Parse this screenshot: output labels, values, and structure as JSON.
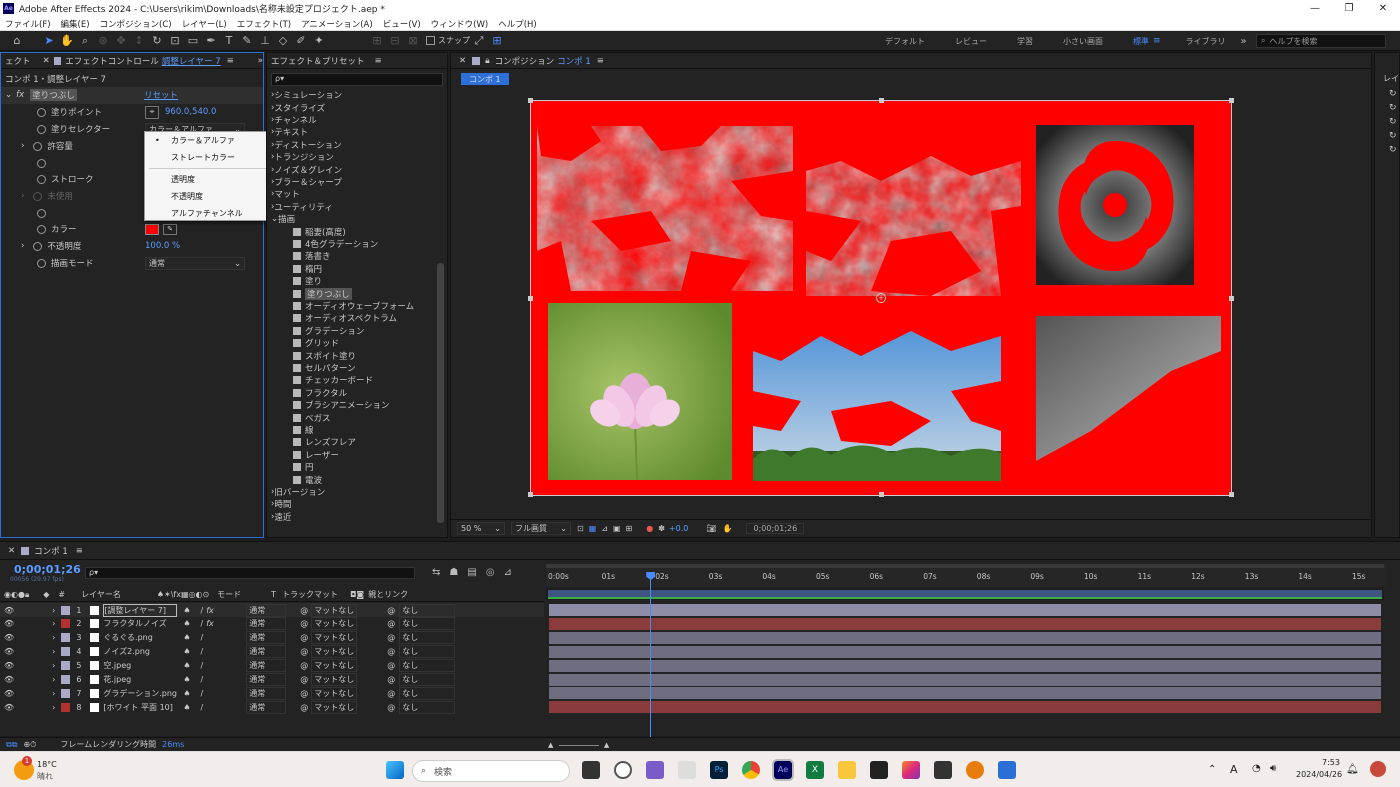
{
  "window": {
    "title": "Adobe After Effects 2024 - C:\\Users\\rikim\\Downloads\\名称未設定プロジェクト.aep *",
    "app_icon": "Ae"
  },
  "menu": [
    "ファイル(F)",
    "編集(E)",
    "コンポジション(C)",
    "レイヤー(L)",
    "エフェクト(T)",
    "アニメーション(A)",
    "ビュー(V)",
    "ウィンドウ(W)",
    "ヘルプ(H)"
  ],
  "toolbar": {
    "snap_label": "スナップ",
    "workspaces": [
      "デフォルト",
      "レビュー",
      "学習",
      "小さい画面",
      "標準",
      "ライブラリ"
    ],
    "active_workspace": "標準",
    "help_placeholder": "ヘルプを検索"
  },
  "effect_controls": {
    "tab_left": "ェクト",
    "tab_label": "エフェクトコントロール",
    "tab_layer": "調整レイヤー 7",
    "breadcrumb": "コンポ 1・調整レイヤー 7",
    "effect_name": "塗りつぶし",
    "reset": "リセット",
    "props": [
      {
        "label": "塗りポイント",
        "value": "960.0,540.0"
      },
      {
        "label": "塗りセレクター",
        "value": "カラー＆アルファ"
      },
      {
        "label": "許容量",
        "value": ""
      },
      {
        "label": "",
        "value": ""
      },
      {
        "label": "ストローク",
        "value": ""
      },
      {
        "label": "未使用",
        "value": ""
      },
      {
        "label": "",
        "value": ""
      },
      {
        "label": "カラー",
        "value": ""
      },
      {
        "label": "不透明度",
        "value": "100.0 %"
      },
      {
        "label": "描画モード",
        "value": "通常"
      }
    ],
    "fill_color": "#ff0000",
    "dropdown_menu": [
      "カラー＆アルファ",
      "ストレートカラー",
      "透明度",
      "不透明度",
      "アルファチャンネル"
    ],
    "dropdown_selected": "カラー＆アルファ"
  },
  "effects_presets": {
    "tab_label": "エフェクト＆プリセット",
    "search_placeholder": "ρ▾",
    "categories_top": [
      "シミュレーション",
      "スタイライズ",
      "チャンネル",
      "テキスト",
      "ディストーション",
      "トランジション",
      "ノイズ＆グレイン",
      "ブラー＆シャープ",
      "マット",
      "ユーティリティ",
      "描画"
    ],
    "draw_items": [
      "稲妻(高度)",
      "4色グラデーション",
      "落書き",
      "楕円",
      "塗り",
      "塗りつぶし",
      "オーディオウェーブフォーム",
      "オーディオスペクトラム",
      "グラデーション",
      "グリッド",
      "スポイト塗り",
      "セルパターン",
      "チェッカーボード",
      "フラクタル",
      "ブラシアニメーション",
      "ベガス",
      "線",
      "レンズフレア",
      "レーザー",
      "円",
      "電波"
    ],
    "highlighted_item": "塗りつぶし",
    "categories_bottom": [
      "旧バージョン",
      "時間",
      "遠近"
    ]
  },
  "composition": {
    "tab_label": "コンポジション",
    "comp_name": "コンポ 1",
    "sub_tab": "コンポ 1",
    "zoom": "50 %",
    "resolution": "フル画質",
    "exposure": "+0.0",
    "timecode": "0;00;01;26",
    "bg_color": "#ff0000"
  },
  "timeline": {
    "tab_label": "コンポ 1",
    "timecode": "0;00;01;26",
    "frame_info": "00056 (29.97 fps)",
    "headers": {
      "num": "#",
      "name": "レイヤー名",
      "mode": "モード",
      "t": "T",
      "track_matte": "トラックマット",
      "parent": "親とリンク"
    },
    "layers": [
      {
        "num": "1",
        "name": "[調整レイヤー 7]",
        "color": "#a9a9c8",
        "mode": "通常",
        "matte": "マットなし",
        "parent": "なし",
        "fx": true
      },
      {
        "num": "2",
        "name": "フラクタルノイズ",
        "color": "#b23232",
        "mode": "通常",
        "matte": "マットなし",
        "parent": "なし",
        "fx": true
      },
      {
        "num": "3",
        "name": "ぐるぐる.png",
        "color": "#a9a9c8",
        "mode": "通常",
        "matte": "マットなし",
        "parent": "なし",
        "fx": false
      },
      {
        "num": "4",
        "name": "ノイズ2.png",
        "color": "#a9a9c8",
        "mode": "通常",
        "matte": "マットなし",
        "parent": "なし",
        "fx": false
      },
      {
        "num": "5",
        "name": "空.jpeg",
        "color": "#a9a9c8",
        "mode": "通常",
        "matte": "マットなし",
        "parent": "なし",
        "fx": false
      },
      {
        "num": "6",
        "name": "花.jpeg",
        "color": "#a9a9c8",
        "mode": "通常",
        "matte": "マットなし",
        "parent": "なし",
        "fx": false
      },
      {
        "num": "7",
        "name": "グラデーション.png",
        "color": "#a9a9c8",
        "mode": "通常",
        "matte": "マットなし",
        "parent": "なし",
        "fx": false
      },
      {
        "num": "8",
        "name": "[ホワイト 平面 10]",
        "color": "#b23232",
        "mode": "通常",
        "matte": "マットなし",
        "parent": "なし",
        "fx": false
      }
    ],
    "ruler": [
      "0:00s",
      "01s",
      "02s",
      "03s",
      "04s",
      "05s",
      "06s",
      "07s",
      "08s",
      "09s",
      "10s",
      "11s",
      "12s",
      "13s",
      "14s",
      "15s"
    ],
    "playhead_seconds": 1.87,
    "duration_seconds": 15.5
  },
  "status": {
    "render_label": "フレームレンダリング時間",
    "render_time": "26ms"
  },
  "taskbar": {
    "weather_temp": "18°C",
    "weather_desc": "晴れ",
    "weather_badge": "1",
    "search_placeholder": "検索",
    "ime": "A",
    "time": "7:53",
    "date": "2024/04/26"
  }
}
